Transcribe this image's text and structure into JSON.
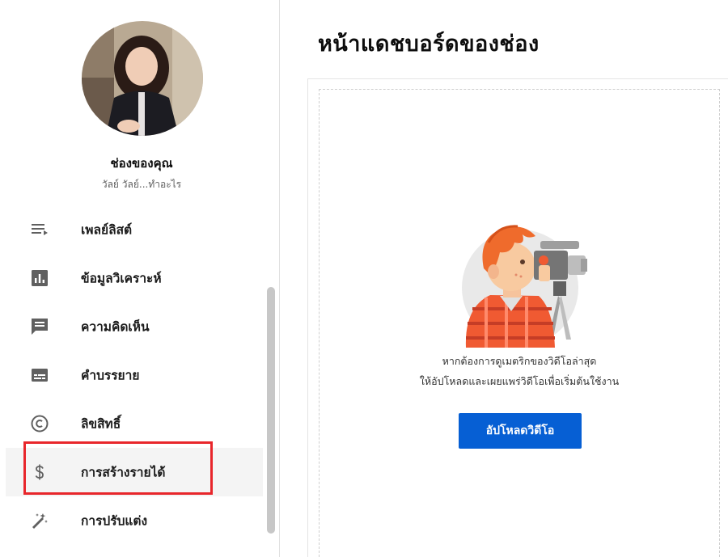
{
  "channel": {
    "title": "ช่องของคุณ",
    "subtitle": "วัลย์ วัลย์...ทำอะไร"
  },
  "sidebar": {
    "items": [
      {
        "label": "เพลย์ลิสต์",
        "icon": "playlist-icon"
      },
      {
        "label": "ข้อมูลวิเคราะห์",
        "icon": "analytics-icon"
      },
      {
        "label": "ความคิดเห็น",
        "icon": "comments-icon"
      },
      {
        "label": "คำบรรยาย",
        "icon": "subtitles-icon"
      },
      {
        "label": "ลิขสิทธิ์",
        "icon": "copyright-icon"
      },
      {
        "label": "การสร้างรายได้",
        "icon": "dollar-icon",
        "active": true,
        "highlighted": true
      },
      {
        "label": "การปรับแต่ง",
        "icon": "magic-wand-icon"
      }
    ]
  },
  "main": {
    "title": "หน้าแดชบอร์ดของช่อง",
    "empty_state": {
      "line1": "หากต้องการดูเมตริกของวิดีโอล่าสุด",
      "line2": "ให้อัปโหลดและเผยแพร่วิดีโอเพื่อเริ่มต้นใช้งาน",
      "button": "อัปโหลดวิดีโอ"
    }
  },
  "colors": {
    "accent": "#065fd4",
    "highlight": "#e8262b",
    "active_row": "#f4f4f4",
    "icon": "#606060"
  }
}
